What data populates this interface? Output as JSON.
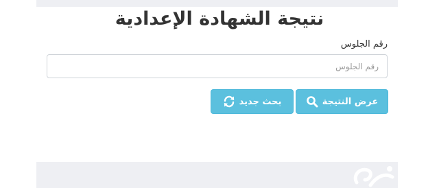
{
  "page": {
    "title": "نتيجة الشهادة الإعدادية"
  },
  "form": {
    "seat_label": "رقم الجلوس",
    "seat_placeholder": "رقم الجلوس",
    "seat_value": ""
  },
  "buttons": {
    "show_result_label": "عرض النتيجة",
    "show_result_icon": "search-icon",
    "new_search_label": "بحث جديد",
    "new_search_icon": "refresh-icon"
  },
  "colors": {
    "button_bg": "#5bc0de",
    "title": "#333333",
    "band": "#eeeff3"
  }
}
